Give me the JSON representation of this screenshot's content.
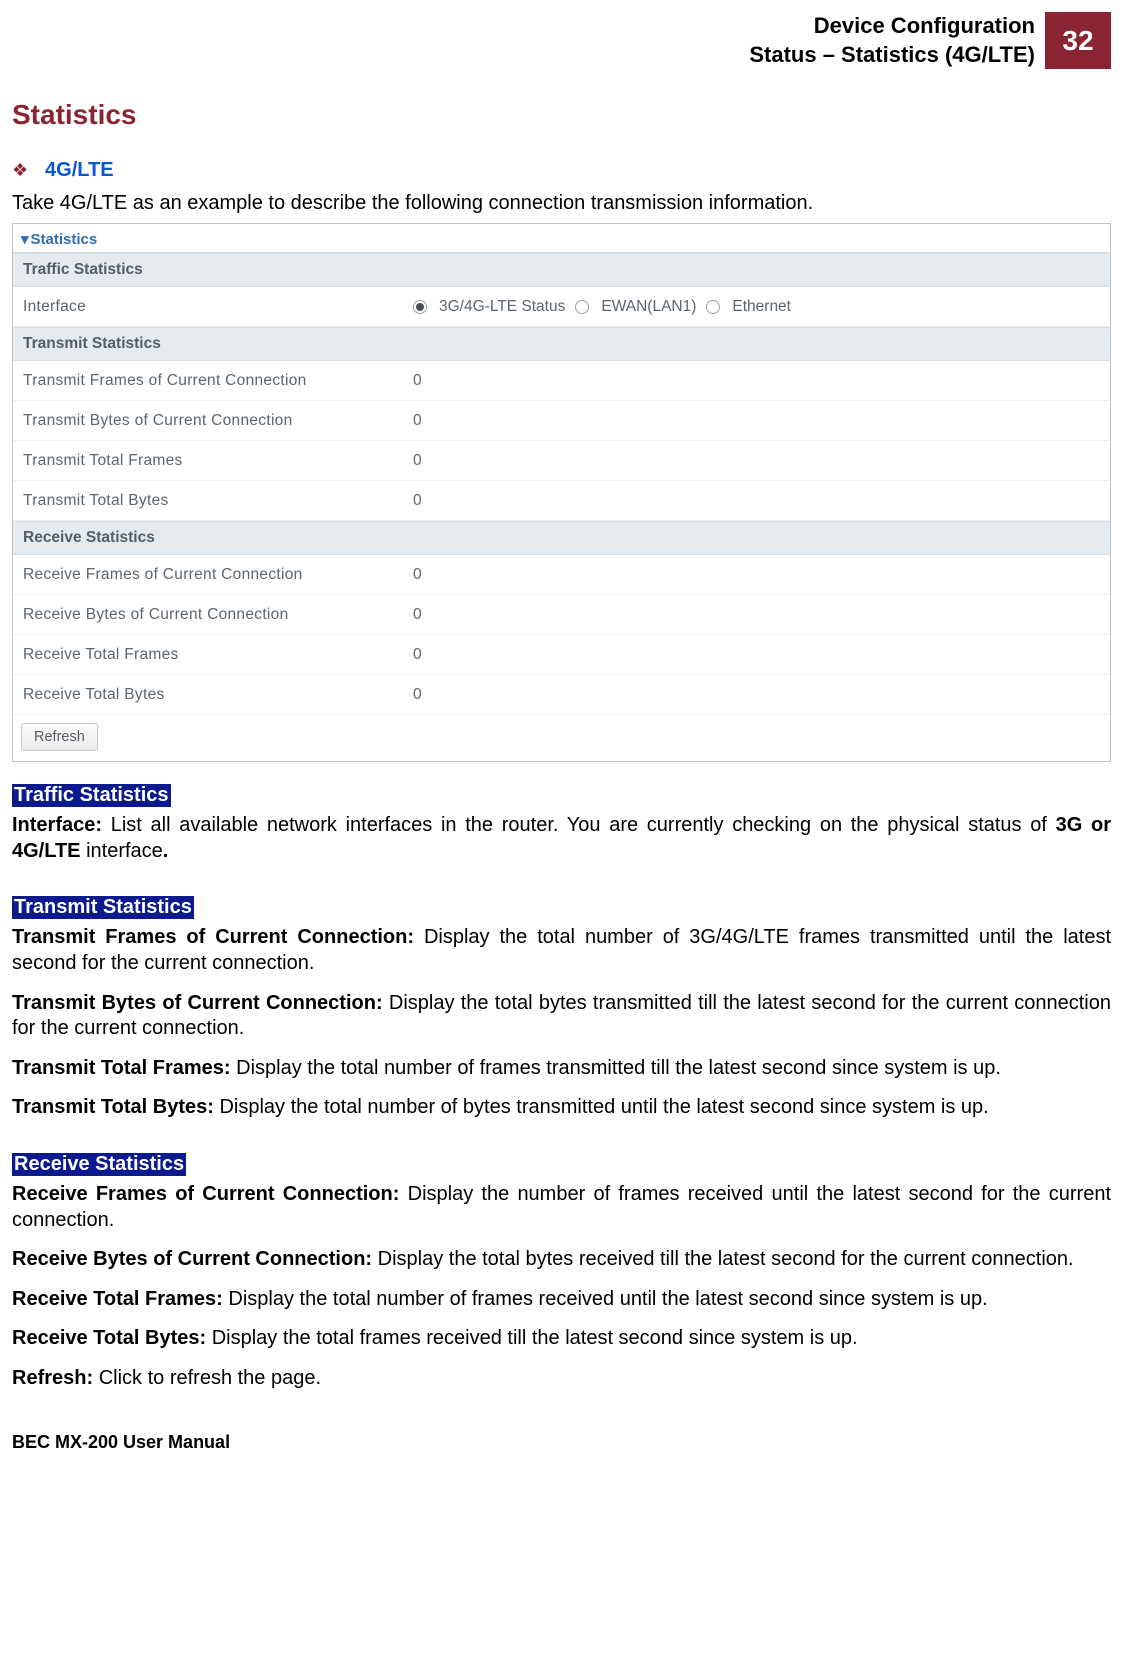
{
  "header": {
    "title_line1": "Device Configuration",
    "title_line2": "Status – Statistics (4G/LTE)",
    "page_number": "32"
  },
  "section_title": "Statistics",
  "sub_heading": "4G/LTE",
  "intro": "Take 4G/LTE as an example to describe the following connection transmission information.",
  "panel": {
    "title": "Statistics",
    "traffic_head": "Traffic Statistics",
    "interface_label": "Interface",
    "radios": {
      "opt1": "3G/4G-LTE Status",
      "opt2": "EWAN(LAN1)",
      "opt3": "Ethernet"
    },
    "transmit_head": "Transmit Statistics",
    "rows_transmit": [
      {
        "label": "Transmit Frames of Current Connection",
        "value": "0"
      },
      {
        "label": "Transmit Bytes of Current Connection",
        "value": "0"
      },
      {
        "label": "Transmit Total Frames",
        "value": "0"
      },
      {
        "label": "Transmit Total Bytes",
        "value": "0"
      }
    ],
    "receive_head": "Receive Statistics",
    "rows_receive": [
      {
        "label": "Receive Frames of Current Connection",
        "value": "0"
      },
      {
        "label": "Receive Bytes of Current Connection",
        "value": "0"
      },
      {
        "label": "Receive Total Frames",
        "value": "0"
      },
      {
        "label": "Receive Total Bytes",
        "value": "0"
      }
    ],
    "refresh_btn": "Refresh"
  },
  "desc": {
    "traffic_hl": "Traffic Statistics",
    "interface_bold": "Interface:",
    "interface_text": " List all available network interfaces in the router.  You are currently checking on the physical status of ",
    "interface_bold2": "3G or 4G/LTE",
    "interface_text2": " interface",
    "interface_dot": ".",
    "transmit_hl": "Transmit Statistics",
    "tx1_b": "Transmit Frames of Current Connection:",
    "tx1_t": " Display the total number of 3G/4G/LTE frames transmitted until the latest second for the current connection.",
    "tx2_b": "Transmit Bytes of Current Connection:",
    "tx2_t": " Display the total bytes transmitted till the latest second for the current connection for the current connection.",
    "tx3_b": "Transmit Total Frames:",
    "tx3_t": " Display the total number of frames transmitted till the latest second since system is up.",
    "tx4_b": "Transmit Total Bytes:",
    "tx4_t": " Display the total number of bytes transmitted until the latest second since system is up.",
    "receive_hl": "Receive Statistics",
    "rx1_b": "Receive Frames of Current Connection:",
    "rx1_t": " Display the number of frames received until the latest second for the current connection.",
    "rx2_b": "Receive Bytes of Current Connection:",
    "rx2_t": " Display the total bytes received till the latest second for the current connection.",
    "rx3_b": "Receive Total Frames:",
    "rx3_t": " Display the total number of frames received until the latest second since system is up.",
    "rx4_b": "Receive Total Bytes:",
    "rx4_t": " Display the total frames received till the latest second since system is up.",
    "refresh_b": "Refresh:",
    "refresh_t": " Click to refresh the page."
  },
  "footer": "BEC MX-200 User Manual"
}
